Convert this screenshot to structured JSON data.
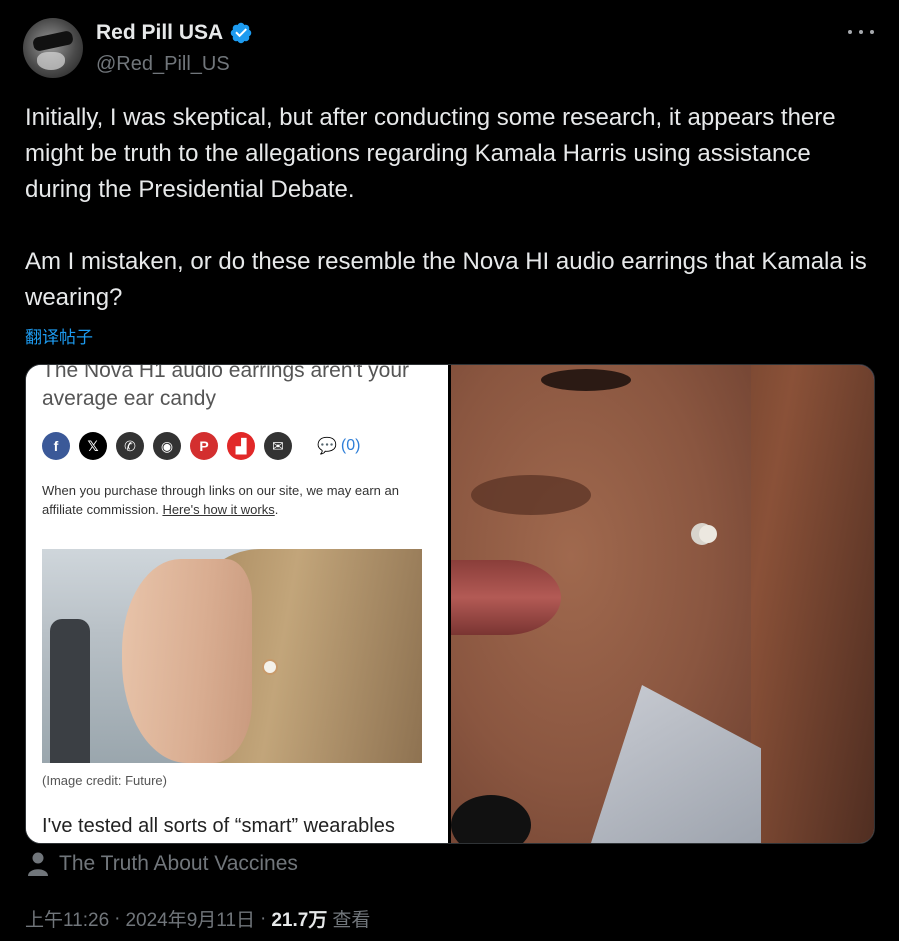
{
  "author": {
    "display_name": "Red Pill USA",
    "handle": "@Red_Pill_US",
    "verified": true
  },
  "tweet": {
    "text": "Initially, I was skeptical, but after conducting some research, it appears there might be truth to the allegations regarding Kamala Harris using assistance during the Presidential Debate.\n\nAm I mistaken, or do these resemble the Nova HI audio earrings that Kamala is wearing?",
    "translate_label": "翻译帖子"
  },
  "media": {
    "article": {
      "headline": "The Nova H1 audio earrings aren't your average ear candy",
      "share_icons": [
        "facebook-icon",
        "x-icon",
        "whatsapp-icon",
        "reddit-icon",
        "pinterest-icon",
        "flipboard-icon",
        "email-icon"
      ],
      "comment_count": "(0)",
      "affiliate_text": "When you purchase through links on our site, we may earn an affiliate commission.",
      "affiliate_link": "Here's how it works",
      "affiliate_end": ".",
      "image_credit": "(Image credit: Future)",
      "body_start": "I've tested all sorts of “smart” wearables"
    }
  },
  "community": {
    "label": "The Truth About Vaccines"
  },
  "meta": {
    "time": "上午11:26",
    "sep1": "·",
    "date": "2024年9月11日",
    "sep2": "·",
    "views_count": "21.7万",
    "views_label": "查看"
  },
  "colors": {
    "background": "#000000",
    "text_primary": "#e7e9ea",
    "text_secondary": "#71767b",
    "accent": "#1d9bf0"
  }
}
